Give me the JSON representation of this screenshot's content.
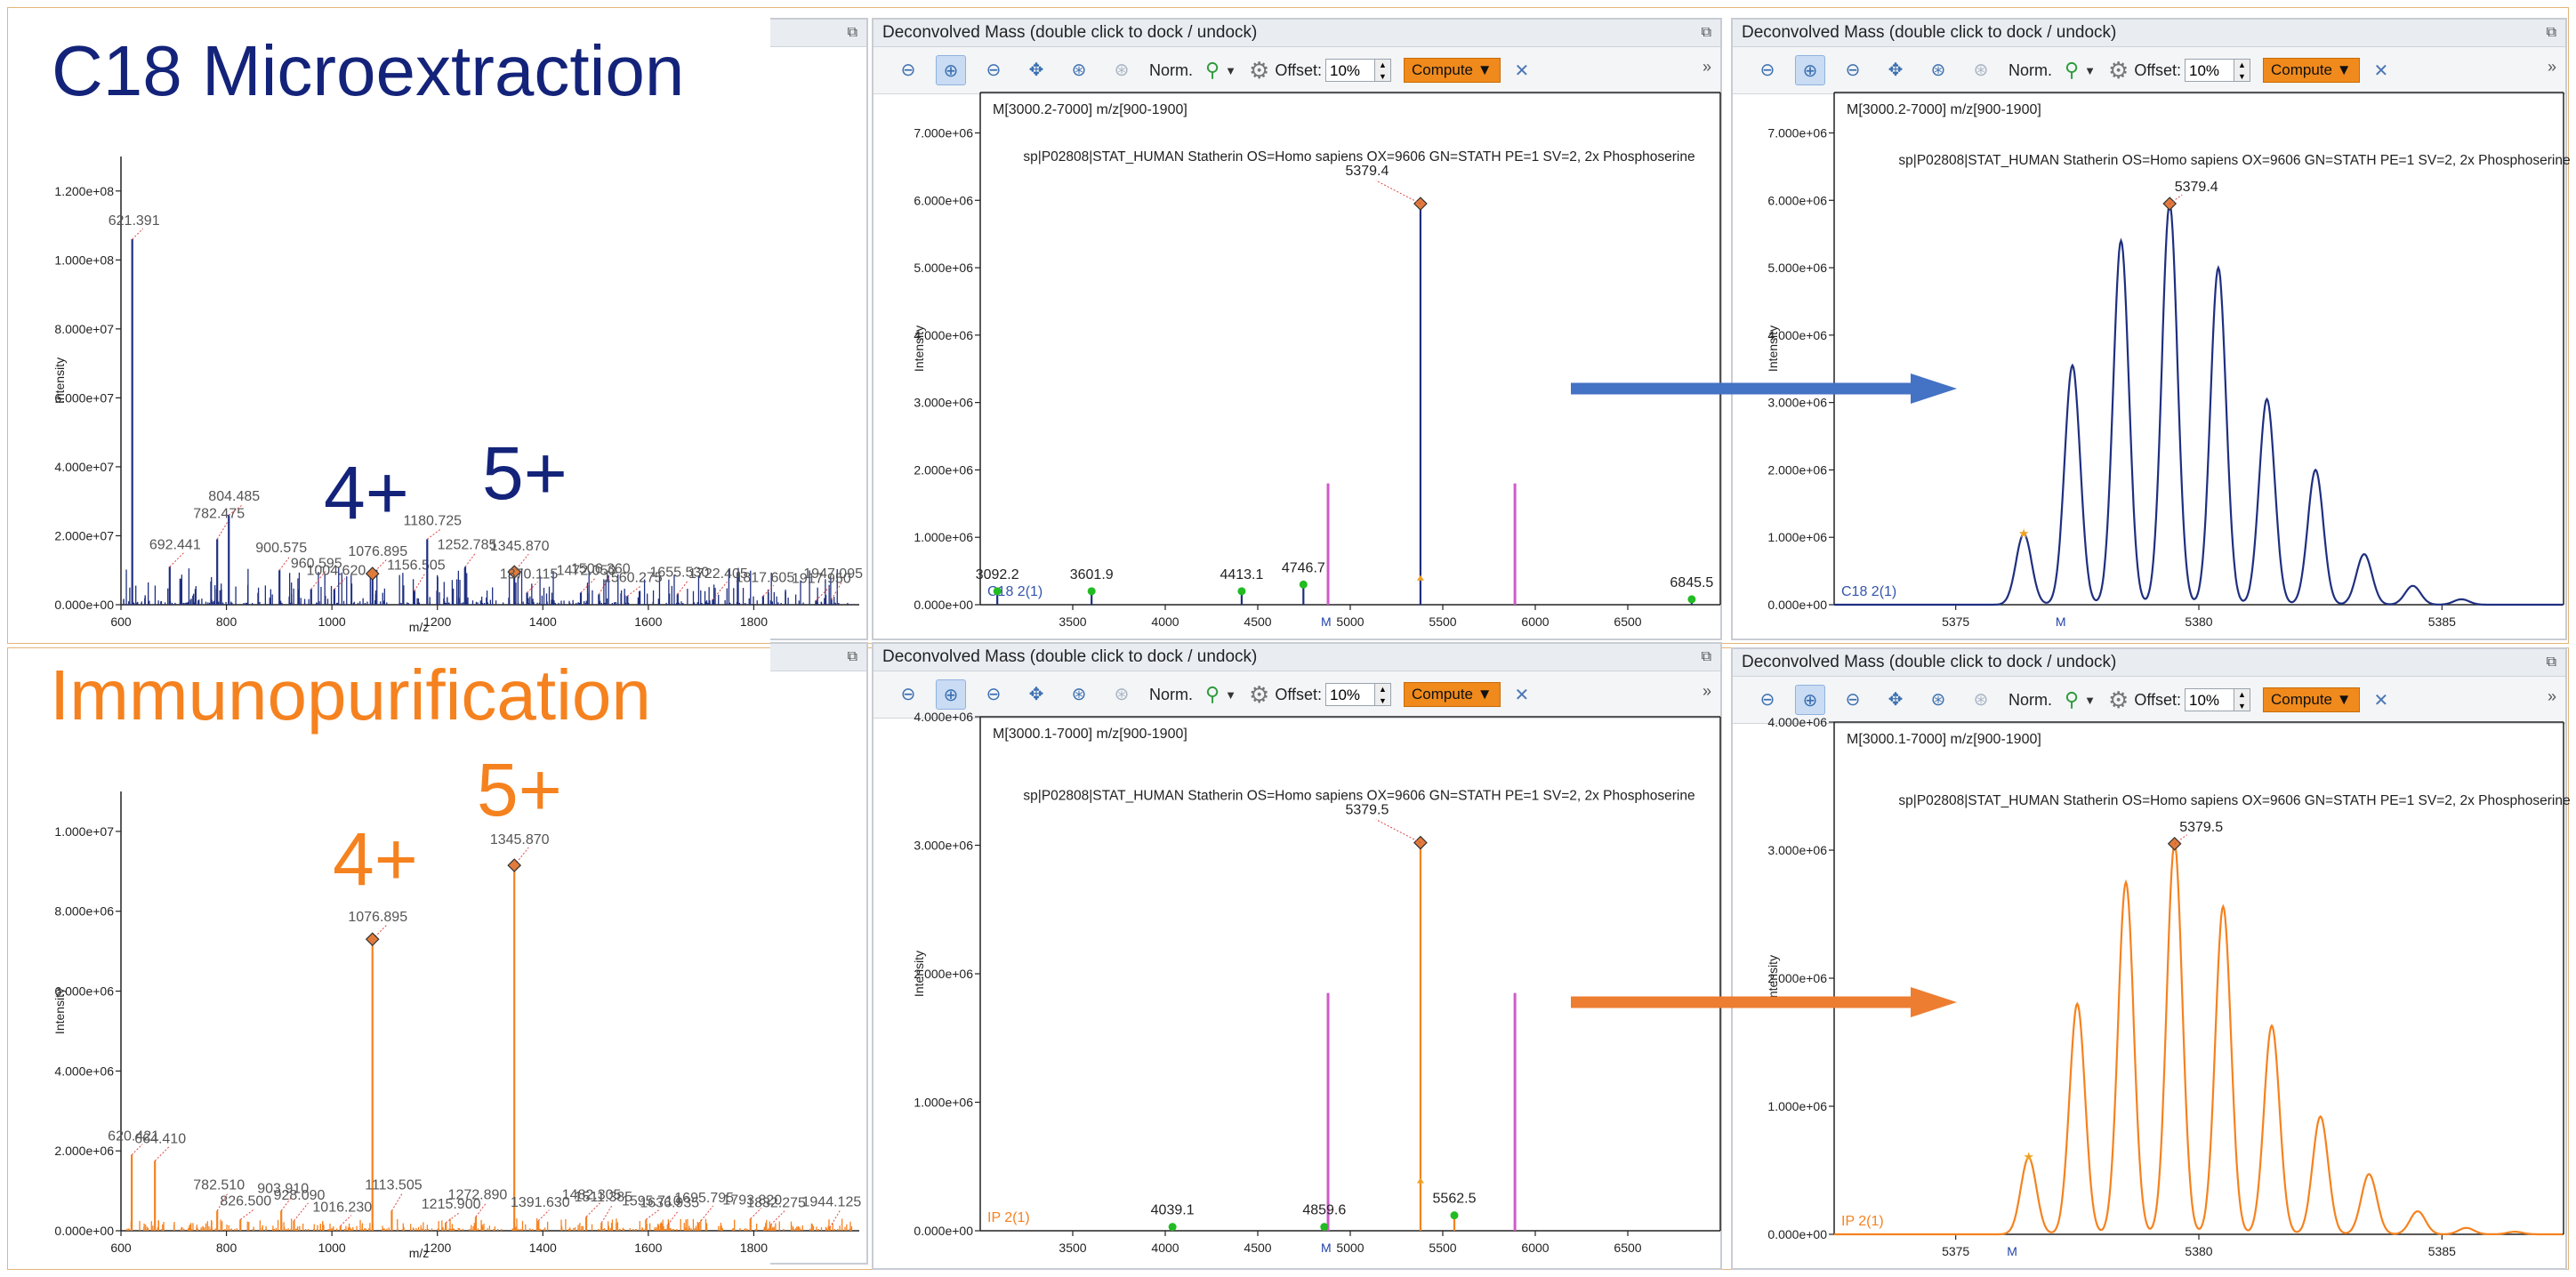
{
  "section_titles": {
    "c18": "C18 Microextraction",
    "ip": "Immunopurification"
  },
  "charge_labels": {
    "c18_4": "4+",
    "c18_5": "5+",
    "ip_4": "4+",
    "ip_5": "5+"
  },
  "colors": {
    "c18": "#14237a",
    "ip": "#f5821f",
    "c18_series": "#1f2f80",
    "ip_series": "#f5821f",
    "marker": "#d05aca",
    "arrow_blue": "#4472c4",
    "arrow_orange": "#ed7d31",
    "peak_marker": "#e07b3c",
    "green_marker": "#22bb22"
  },
  "panels": {
    "deconv_title": "Deconvolved Mass (double click to dock / undock)",
    "dock_icon": "restore-icon",
    "toolbar": {
      "norm_label": "Norm.",
      "offset_label": "Offset:",
      "offset_value": "10%",
      "compute_label": "Compute",
      "more": "»"
    }
  },
  "chart_data": [
    {
      "id": "c18_spectrum",
      "type": "bar",
      "xlabel": "m/z",
      "ylabel": "Intensity",
      "xlim": [
        600,
        2000
      ],
      "ylim": [
        0,
        130000000
      ],
      "xticks": [
        "600",
        "800",
        "1000",
        "1200",
        "1400",
        "1600",
        "1800"
      ],
      "yticks": [
        "0.000e+00",
        "2.000e+07",
        "4.000e+07",
        "6.000e+07",
        "8.000e+07",
        "1.000e+08",
        "1.200e+08"
      ],
      "peaks": [
        {
          "x": 621.391,
          "y": 106000000,
          "label": "621.391"
        },
        {
          "x": 692.441,
          "y": 11000000,
          "label": "692.441"
        },
        {
          "x": 782.475,
          "y": 19000000,
          "label": "782.475"
        },
        {
          "x": 804.485,
          "y": 26000000,
          "label": "804.485"
        },
        {
          "x": 900.575,
          "y": 10000000,
          "label": "900.575"
        },
        {
          "x": 960.595,
          "y": 4500000,
          "label": "960.595"
        },
        {
          "x": 1004.62,
          "y": 4500000,
          "label": "1004.620"
        },
        {
          "x": 1076.895,
          "y": 9000000,
          "label": "1076.895",
          "marked": true
        },
        {
          "x": 1156.505,
          "y": 4000000,
          "label": "1156.505"
        },
        {
          "x": 1180.725,
          "y": 19000000,
          "label": "1180.725"
        },
        {
          "x": 1252.785,
          "y": 11000000,
          "label": "1252.785"
        },
        {
          "x": 1345.87,
          "y": 9500000,
          "label": "1345.870",
          "marked": true
        },
        {
          "x": 1370.115,
          "y": 3500000,
          "label": "1370.115"
        },
        {
          "x": 1472.05,
          "y": 3500000,
          "label": "1472.050"
        },
        {
          "x": 1506.36,
          "y": 3000000,
          "label": "1506.360"
        },
        {
          "x": 1560.275,
          "y": 2500000,
          "label": "1560.275"
        },
        {
          "x": 1655.53,
          "y": 3000000,
          "label": "1655.530"
        },
        {
          "x": 1722.405,
          "y": 1500000,
          "label": "1722.405"
        },
        {
          "x": 1817.605,
          "y": 2500000,
          "label": "1817.605"
        },
        {
          "x": 1917.95,
          "y": 1200000,
          "label": "1917.950"
        },
        {
          "x": 1947.095,
          "y": 1500000,
          "label": "1947.095"
        }
      ]
    },
    {
      "id": "c18_deconv",
      "type": "bar",
      "ylabel": "Intensity",
      "header": "M[3000.2-7000] m/z[900-1900]",
      "legend": "C18 2(1)",
      "annotation": "sp|P02808|STAT_HUMAN Statherin OS=Homo sapiens OX=9606 GN=STATH PE=1 SV=2, 2x Phosphoserine",
      "xlim": [
        3000,
        7000
      ],
      "ylim": [
        0,
        7600000
      ],
      "xticks": [
        "3500",
        "4000",
        "4500",
        "5000",
        "5500",
        "6000",
        "6500"
      ],
      "yticks": [
        "0.000e+00",
        "1.000e+06",
        "2.000e+06",
        "3.000e+06",
        "4.000e+06",
        "5.000e+06",
        "6.000e+06",
        "7.000e+06"
      ],
      "m_label": "M",
      "m_x": 4880,
      "markers_x": [
        4880,
        5890
      ],
      "markers_height": 1800000,
      "peaks": [
        {
          "x": 3092.2,
          "y": 200000,
          "label": "3092.2"
        },
        {
          "x": 3601.9,
          "y": 200000,
          "label": "3601.9"
        },
        {
          "x": 4413.1,
          "y": 200000,
          "label": "4413.1"
        },
        {
          "x": 4746.7,
          "y": 300000,
          "label": "4746.7"
        },
        {
          "x": 5379.4,
          "y": 5950000,
          "label": "5379.4",
          "marked": true
        },
        {
          "x": 6845.5,
          "y": 80000,
          "label": "6845.5"
        }
      ]
    },
    {
      "id": "c18_zoom",
      "type": "line",
      "ylabel": "Intensity",
      "header": "M[3000.2-7000] m/z[900-1900]",
      "legend": "C18 2(1)",
      "annotation": "sp|P02808|STAT_HUMAN Statherin OS=Homo sapiens OX=9606 GN=STATH PE=1 SV=2, 2x Phosphoserine",
      "peak_label": "5379.4",
      "xlim": [
        5372.5,
        5387.5
      ],
      "ylim": [
        0,
        7600000
      ],
      "xticks": [
        "5375",
        "5380",
        "5385"
      ],
      "yticks": [
        "0.000e+00",
        "1.000e+06",
        "2.000e+06",
        "3.000e+06",
        "4.000e+06",
        "5.000e+06",
        "6.000e+06",
        "7.000e+06"
      ],
      "m_label": "M",
      "m_x": 5377.2,
      "isotopes": [
        {
          "x": 5376.4,
          "y": 1050000
        },
        {
          "x": 5377.4,
          "y": 3550000
        },
        {
          "x": 5378.4,
          "y": 5400000
        },
        {
          "x": 5379.4,
          "y": 5950000
        },
        {
          "x": 5380.4,
          "y": 5000000
        },
        {
          "x": 5381.4,
          "y": 3050000
        },
        {
          "x": 5382.4,
          "y": 2000000
        },
        {
          "x": 5383.4,
          "y": 750000
        },
        {
          "x": 5384.4,
          "y": 280000
        },
        {
          "x": 5385.4,
          "y": 80000
        }
      ]
    },
    {
      "id": "ip_spectrum",
      "type": "bar",
      "xlabel": "m/z",
      "ylabel": "Intensity",
      "xlim": [
        600,
        2000
      ],
      "ylim": [
        0,
        11000000
      ],
      "xticks": [
        "600",
        "800",
        "1000",
        "1200",
        "1400",
        "1600",
        "1800"
      ],
      "yticks": [
        "0.000e+00",
        "2.000e+06",
        "4.000e+06",
        "6.000e+06",
        "8.000e+06",
        "1.000e+07"
      ],
      "peaks": [
        {
          "x": 620.421,
          "y": 1900000,
          "label": "620.421"
        },
        {
          "x": 664.41,
          "y": 1750000,
          "label": "664.410"
        },
        {
          "x": 782.51,
          "y": 500000,
          "label": "782.510"
        },
        {
          "x": 826.5,
          "y": 280000,
          "label": "826.500"
        },
        {
          "x": 903.91,
          "y": 500000,
          "label": "903.910"
        },
        {
          "x": 928.09,
          "y": 250000,
          "label": "928.090"
        },
        {
          "x": 1016.23,
          "y": 120000,
          "label": "1016.230"
        },
        {
          "x": 1076.895,
          "y": 7300000,
          "label": "1076.895",
          "marked": true
        },
        {
          "x": 1113.505,
          "y": 500000,
          "label": "1113.505"
        },
        {
          "x": 1215.9,
          "y": 200000,
          "label": "1215.900"
        },
        {
          "x": 1272.89,
          "y": 350000,
          "label": "1272.890"
        },
        {
          "x": 1345.87,
          "y": 9150000,
          "label": "1345.870",
          "marked": true
        },
        {
          "x": 1391.63,
          "y": 250000,
          "label": "1391.630"
        },
        {
          "x": 1482.305,
          "y": 350000,
          "label": "1482.305"
        },
        {
          "x": 1511.385,
          "y": 200000,
          "label": "1511.385"
        },
        {
          "x": 1595.71,
          "y": 280000,
          "label": "1595.710"
        },
        {
          "x": 1636.935,
          "y": 150000,
          "label": "1636.935"
        },
        {
          "x": 1695.795,
          "y": 180000,
          "label": "1695.795"
        },
        {
          "x": 1793.82,
          "y": 300000,
          "label": "1793.820"
        },
        {
          "x": 1832.275,
          "y": 150000,
          "label": "1832.275"
        },
        {
          "x": 1944.125,
          "y": 80000,
          "label": "1944.125"
        }
      ]
    },
    {
      "id": "ip_deconv",
      "type": "bar",
      "ylabel": "Intensity",
      "header": "M[3000.1-7000] m/z[900-1900]",
      "legend": "IP 2(1)",
      "annotation": "sp|P02808|STAT_HUMAN Statherin OS=Homo sapiens OX=9606 GN=STATH PE=1 SV=2, 2x Phosphoserine",
      "xlim": [
        3000,
        7000
      ],
      "ylim": [
        0,
        4000000
      ],
      "xticks": [
        "3500",
        "4000",
        "4500",
        "5000",
        "5500",
        "6000",
        "6500"
      ],
      "yticks": [
        "0.000e+00",
        "1.000e+06",
        "2.000e+06",
        "3.000e+06",
        "4.000e+06"
      ],
      "m_label": "M",
      "m_x": 4880,
      "markers_x": [
        4880,
        5890
      ],
      "markers_height": 1850000,
      "peaks": [
        {
          "x": 4039.1,
          "y": 30000,
          "label": "4039.1"
        },
        {
          "x": 4859.6,
          "y": 30000,
          "label": "4859.6"
        },
        {
          "x": 5379.5,
          "y": 3020000,
          "label": "5379.5",
          "marked": true
        },
        {
          "x": 5562.5,
          "y": 120000,
          "label": "5562.5"
        }
      ]
    },
    {
      "id": "ip_zoom",
      "type": "line",
      "ylabel": "Intensity",
      "header": "M[3000.1-7000] m/z[900-1900]",
      "legend": "IP 2(1)",
      "annotation": "sp|P02808|STAT_HUMAN Statherin OS=Homo sapiens OX=9606 GN=STATH PE=1 SV=2, 2x Phosphoserine",
      "peak_label": "5379.5",
      "xlim": [
        5372.5,
        5387.5
      ],
      "ylim": [
        0,
        4000000
      ],
      "xticks": [
        "5375",
        "5380",
        "5385"
      ],
      "yticks": [
        "0.000e+00",
        "1.000e+06",
        "2.000e+06",
        "3.000e+06",
        "4.000e+06"
      ],
      "m_label": "M",
      "m_x": 5376.2,
      "isotopes": [
        {
          "x": 5376.5,
          "y": 600000
        },
        {
          "x": 5377.5,
          "y": 1800000
        },
        {
          "x": 5378.5,
          "y": 2750000
        },
        {
          "x": 5379.5,
          "y": 3050000
        },
        {
          "x": 5380.5,
          "y": 2560000
        },
        {
          "x": 5381.5,
          "y": 1630000
        },
        {
          "x": 5382.5,
          "y": 920000
        },
        {
          "x": 5383.5,
          "y": 470000
        },
        {
          "x": 5384.5,
          "y": 180000
        },
        {
          "x": 5385.5,
          "y": 50000
        },
        {
          "x": 5386.5,
          "y": 20000
        }
      ]
    }
  ]
}
